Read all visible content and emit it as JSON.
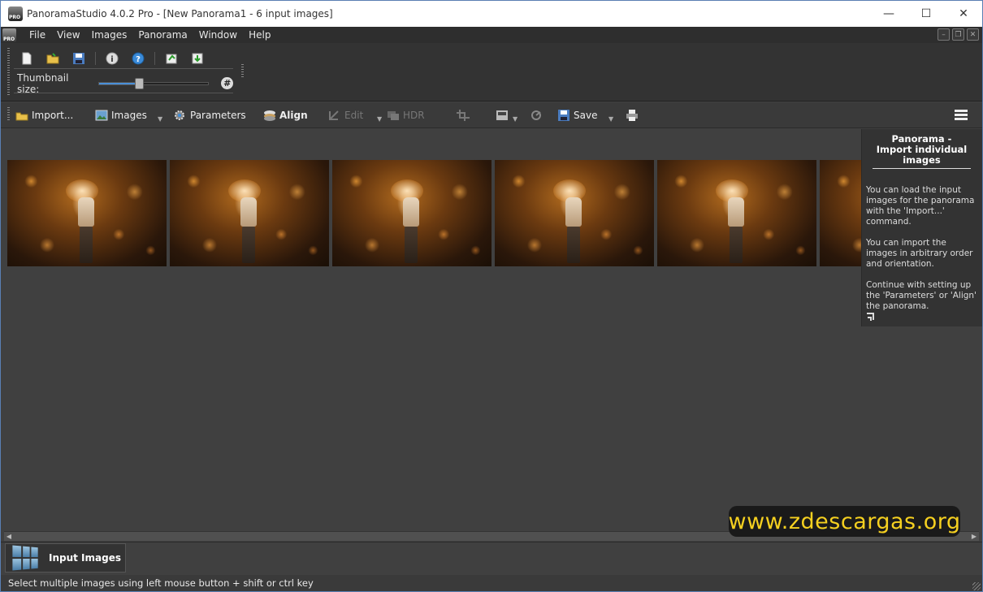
{
  "window": {
    "title": "PanoramaStudio 4.0.2 Pro - [New Panorama1 - 6 input images]",
    "minimize": "—",
    "maximize": "☐",
    "close": "✕"
  },
  "menu": [
    "File",
    "View",
    "Images",
    "Panorama",
    "Window",
    "Help"
  ],
  "upper_toolbar": {
    "icons": [
      "new-file-icon",
      "open-folder-icon",
      "save-disk-icon",
      "info-icon",
      "help-icon",
      "export-icon",
      "import-icon"
    ],
    "thumbnail_label": "Thumbnail size:",
    "thumbnail_value_fraction": 0.35,
    "hash_label": "#"
  },
  "main_toolbar": {
    "import": "Import...",
    "images": "Images",
    "parameters": "Parameters",
    "align": "Align",
    "edit": "Edit",
    "hdr": "HDR",
    "save": "Save"
  },
  "help_panel": {
    "title": "Panorama - Import individual images",
    "paragraphs": [
      "You can load the input images for the panorama with the 'Import...' command.",
      "You can import the images in arbitrary order and orientation.",
      "Continue with setting up the 'Parameters' or 'Align' the panorama."
    ]
  },
  "watermark": "www.zdescargas.org",
  "tabs": {
    "input_images": "Input Images"
  },
  "status": "Select multiple images using left mouse button + shift or ctrl key",
  "colors": {
    "accent": "#4a90d9",
    "watermark_text": "#f5d020",
    "background": "#404040"
  }
}
